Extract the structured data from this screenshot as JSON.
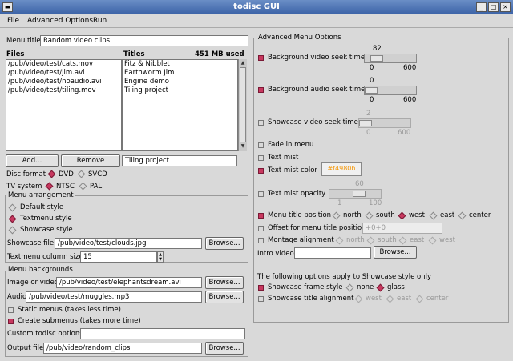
{
  "window": {
    "title": "todisc GUI"
  },
  "menu": [
    "File",
    "Advanced Options",
    "Run"
  ],
  "left": {
    "menu_title_label": "Menu title",
    "menu_title_value": "Random video clips",
    "files_header": "Files",
    "titles_header": "Titles",
    "used": "451 MB used",
    "files": [
      "/pub/video/test/cats.mov",
      "/pub/video/test/jim.avi",
      "/pub/video/test/noaudio.avi",
      "/pub/video/test/tiling.mov"
    ],
    "titles": [
      "Fitz & Nibblet",
      "Earthworm Jim",
      "Engine demo",
      "Tiling project"
    ],
    "add_label": "Add...",
    "remove_label": "Remove",
    "title_edit_value": "Tiling project",
    "disc_format_label": "Disc format",
    "dvd": "DVD",
    "svcd": "SVCD",
    "tv_system_label": "TV system",
    "ntsc": "NTSC",
    "pal": "PAL",
    "arrangement_label": "Menu arrangement",
    "default_style": "Default style",
    "textmenu_style": "Textmenu style",
    "showcase_style": "Showcase style",
    "showcase_file_label": "Showcase file",
    "showcase_file_value": "/pub/video/test/clouds.jpg",
    "browse_label": "Browse...",
    "textmenu_col_label": "Textmenu column size",
    "textmenu_col_value": "15",
    "backgrounds_label": "Menu backgrounds",
    "image_video_label": "Image or video",
    "image_video_value": "/pub/video/test/elephantsdream.avi",
    "audio_label": "Audio",
    "audio_value": "/pub/video/test/muggles.mp3",
    "static_menus": "Static menus (takes less time)",
    "create_submenus": "Create submenus (takes more time)",
    "custom_options_label": "Custom todisc options",
    "output_file_label": "Output file",
    "output_file_value": "/pub/video/random_clips"
  },
  "right": {
    "frame_label": "Advanced Menu Options",
    "bg_video_seek_label": "Background video seek time",
    "bg_video_seek": {
      "value": 82,
      "min": 0,
      "max": 600
    },
    "bg_audio_seek_label": "Background audio seek time",
    "bg_audio_seek": {
      "value": 0,
      "min": 0,
      "max": 600
    },
    "showcase_seek_label": "Showcase video seek time",
    "showcase_seek": {
      "value": 2,
      "min": 0,
      "max": 600
    },
    "fade_in_menu": "Fade in menu",
    "text_mist": "Text mist",
    "text_mist_color_label": "Text mist color",
    "text_mist_color": "#f4980b",
    "text_mist_opacity_label": "Text mist opacity",
    "text_mist_opacity": {
      "value": 60,
      "min": 1,
      "max": 100
    },
    "menu_title_position_label": "Menu title position",
    "positions": [
      "north",
      "south",
      "west",
      "east",
      "center"
    ],
    "offset_label": "Offset for menu title position",
    "offset_value": "+0+0",
    "montage_alignment_label": "Montage alignment",
    "montage_positions": [
      "north",
      "south",
      "east",
      "west"
    ],
    "intro_video_label": "Intro video",
    "browse_label": "Browse...",
    "showcase_note": "The following options apply to Showcase style only",
    "showcase_frame_style_label": "Showcase frame style",
    "frame_styles": [
      "none",
      "glass"
    ],
    "showcase_title_alignment_label": "Showcase title alignment",
    "title_alignments": [
      "west",
      "east",
      "center"
    ]
  }
}
